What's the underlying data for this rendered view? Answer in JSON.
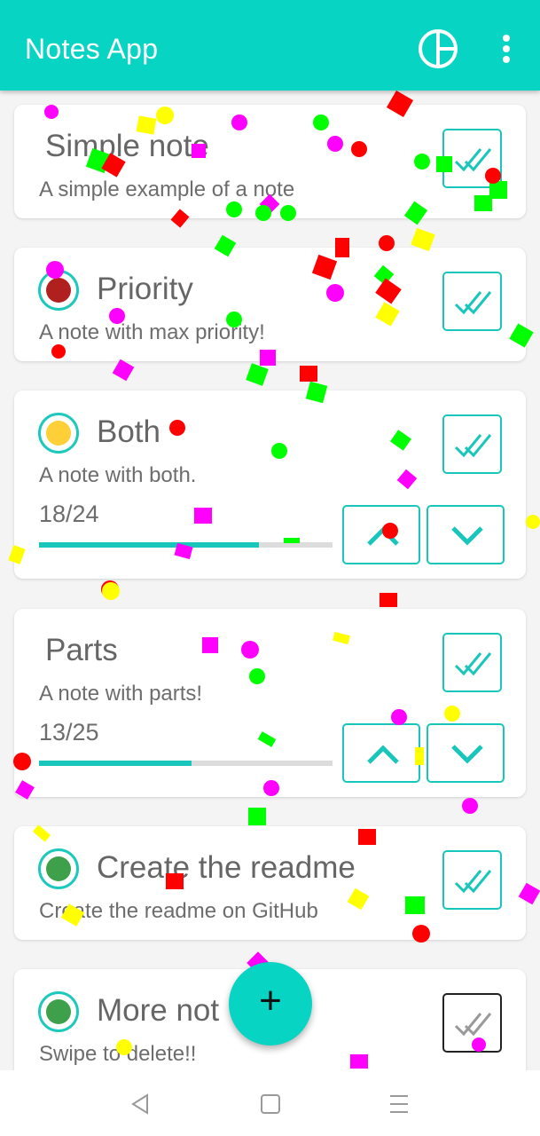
{
  "app_bar": {
    "title": "Notes App",
    "background": "#08d4c4",
    "actions": [
      {
        "icon": "pie-chart-icon"
      },
      {
        "icon": "more-vert-icon"
      }
    ]
  },
  "notes": [
    {
      "title": "Simple note",
      "description": "A simple example of a note",
      "priority": null,
      "done": true
    },
    {
      "title": "Priority",
      "description": "A note with max priority!",
      "priority": "max",
      "priority_color": "#b0201f",
      "done": true
    },
    {
      "title": "Both",
      "description": "A note with both.",
      "priority": "medium",
      "priority_color": "#fecf36",
      "count": "18/24",
      "progress": 0.75,
      "done": true
    },
    {
      "title": "Parts",
      "description": "A note with parts!",
      "priority": null,
      "count": "13/25",
      "progress": 0.52,
      "done": true
    },
    {
      "title": "Create the readme",
      "description": "Create the readme on GitHub",
      "priority": "low",
      "priority_color": "#3ea04a",
      "done": true
    },
    {
      "title": "More not",
      "description": "Swipe to delete!!",
      "priority": "low",
      "priority_color": "#3ea04a",
      "done": false
    }
  ],
  "fab": {
    "label": "+",
    "icon": "add-icon"
  },
  "nav": [
    {
      "icon": "back-triangle-icon"
    },
    {
      "icon": "home-square-icon"
    },
    {
      "icon": "menu-lines-icon"
    }
  ],
  "colors": {
    "accent": "#08d4c4",
    "confetti": [
      "#ff0000",
      "#00ff00",
      "#ff00ff",
      "#ffff00"
    ]
  }
}
